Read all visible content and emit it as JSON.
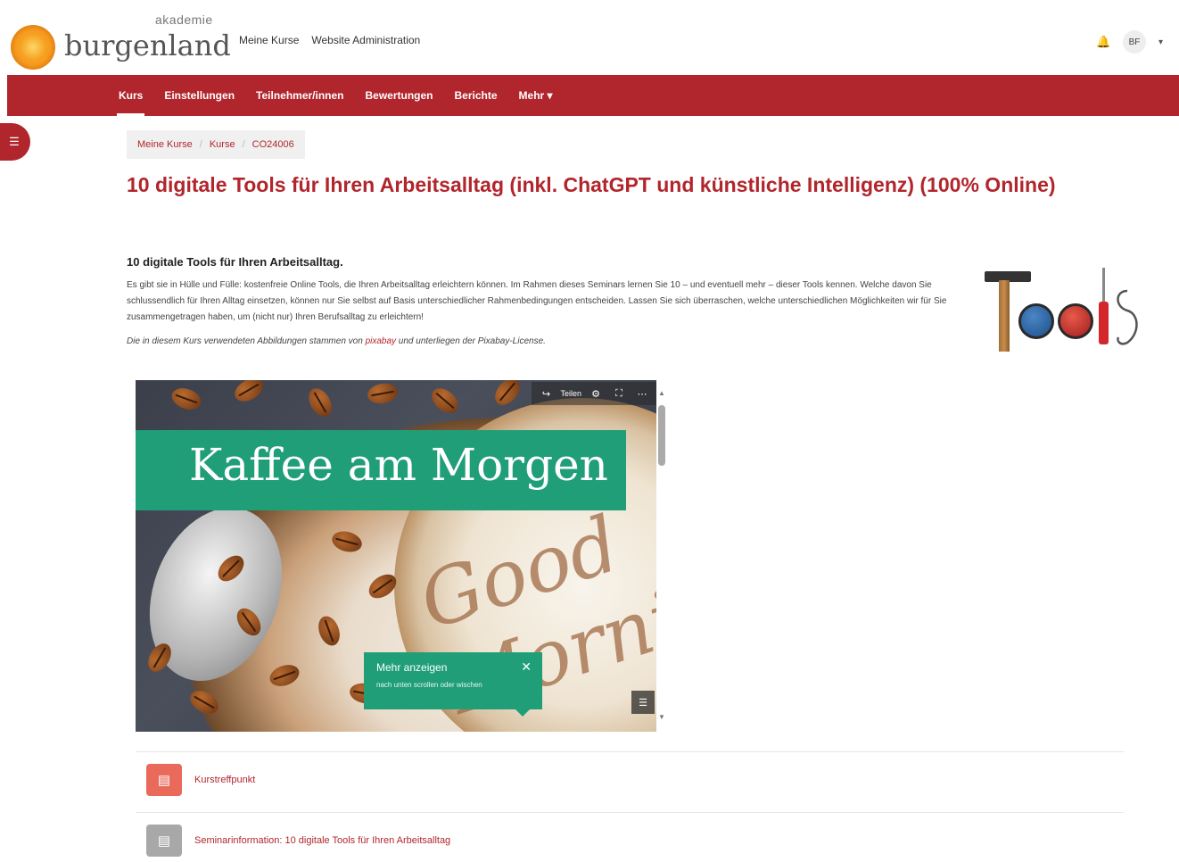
{
  "logo": {
    "small": "akademie",
    "big": "burgenland"
  },
  "topnav": {
    "items": [
      "Meine Kurse",
      "Website Administration"
    ]
  },
  "user": {
    "bell_icon": "bell-icon",
    "initials": "BF",
    "caret": "▾"
  },
  "secondary_nav": {
    "items": [
      {
        "label": "Kurs",
        "active": true
      },
      {
        "label": "Einstellungen"
      },
      {
        "label": "Teilnehmer/innen"
      },
      {
        "label": "Bewertungen"
      },
      {
        "label": "Berichte"
      },
      {
        "label": "Mehr ▾"
      }
    ]
  },
  "drawer": {
    "icon": "list-icon",
    "glyph": "☰"
  },
  "breadcrumb": {
    "items": [
      "Meine Kurse",
      "Kurse",
      "CO24006"
    ],
    "separator": "/"
  },
  "course": {
    "title": "10 digitale Tools für Ihren Arbeitsalltag (inkl. ChatGPT und künstliche Intelligenz) (100% Online)"
  },
  "summary": {
    "heading": "10 digitale Tools für Ihren Arbeitsalltag.",
    "text": "Es gibt sie in Hülle und Fülle: kostenfreie Online Tools, die Ihren Arbeitsalltag erleichtern können. Im Rahmen dieses Seminars lernen Sie 10 – und eventuell mehr – dieser Tools kennen. Welche davon Sie schlussendlich für Ihren Alltag einsetzen, können nur Sie selbst auf Basis unterschiedlicher Rahmenbedingungen entscheiden. Lassen Sie sich überraschen, welche unterschiedlichen Möglichkeiten wir für Sie zusammengetragen haben, um (nicht nur) Ihren Berufsalltag zu erleichtern!",
    "note_prefix": "Die in diesem Kurs verwendeten Abbildungen stammen von ",
    "note_link": "pixabay",
    "note_suffix": " und unterliegen der Pixabay-License."
  },
  "tools_image": {
    "letters_left": "T",
    "letters_right": "S"
  },
  "media": {
    "banner_text": "Kaffee am Morgen",
    "latte_text": "Good Mornin",
    "toolbar": {
      "share_label": "Teilen",
      "share_icon": "share-icon",
      "settings_icon": "gear-icon",
      "fullscreen_icon": "fullscreen-icon",
      "more_icon": "more-icon"
    },
    "tooltip": {
      "title": "Mehr anzeigen",
      "subtitle": "nach unten scrollen oder wischen",
      "close": "✕"
    },
    "corner_icon": "menu-icon"
  },
  "activities": [
    {
      "name": "Kurstreffpunkt",
      "icon": "forum-icon",
      "color": "#e96a5a",
      "glyph": "💬"
    },
    {
      "name": "Seminarinformation: 10 digitale Tools für Ihren Arbeitsalltag",
      "icon": "file-icon",
      "color": "#a8a8a8",
      "glyph": "▤"
    }
  ]
}
